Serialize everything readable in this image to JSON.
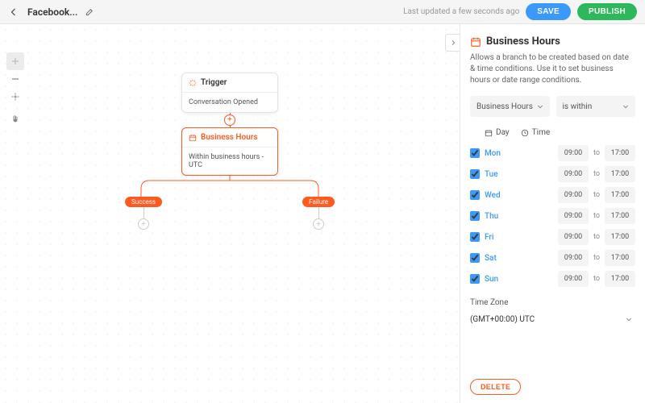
{
  "header": {
    "flow_name": "Facebook...",
    "last_updated": "Last updated a few seconds ago",
    "save_label": "SAVE",
    "publish_label": "PUBLISH"
  },
  "canvas": {
    "trigger": {
      "title": "Trigger",
      "body": "Conversation Opened"
    },
    "business_hours": {
      "title": "Business Hours",
      "body": "Within business hours - UTC"
    },
    "branches": {
      "success": "Success",
      "failure": "Failure"
    }
  },
  "sidebar": {
    "title": "Business Hours",
    "description": "Allows a branch to be created based on date & time conditions. Use it to set business hours or date range conditions.",
    "select_field": "Business Hours",
    "select_condition": "is within",
    "tab_day": "Day",
    "tab_time": "Time",
    "days": [
      {
        "label": "Mon",
        "checked": true,
        "from": "09:00",
        "to": "17:00"
      },
      {
        "label": "Tue",
        "checked": true,
        "from": "09:00",
        "to": "17:00"
      },
      {
        "label": "Wed",
        "checked": true,
        "from": "09:00",
        "to": "17:00"
      },
      {
        "label": "Thu",
        "checked": true,
        "from": "09:00",
        "to": "17:00"
      },
      {
        "label": "Fri",
        "checked": true,
        "from": "09:00",
        "to": "17:00"
      },
      {
        "label": "Sat",
        "checked": true,
        "from": "09:00",
        "to": "17:00"
      },
      {
        "label": "Sun",
        "checked": true,
        "from": "09:00",
        "to": "17:00"
      }
    ],
    "to_label": "to",
    "timezone_label": "Time Zone",
    "timezone_value": "(GMT+00:00) UTC",
    "delete_label": "DELETE"
  },
  "colors": {
    "accent": "#ff5a1f",
    "primary": "#3b99fc",
    "success": "#2eb85c"
  }
}
